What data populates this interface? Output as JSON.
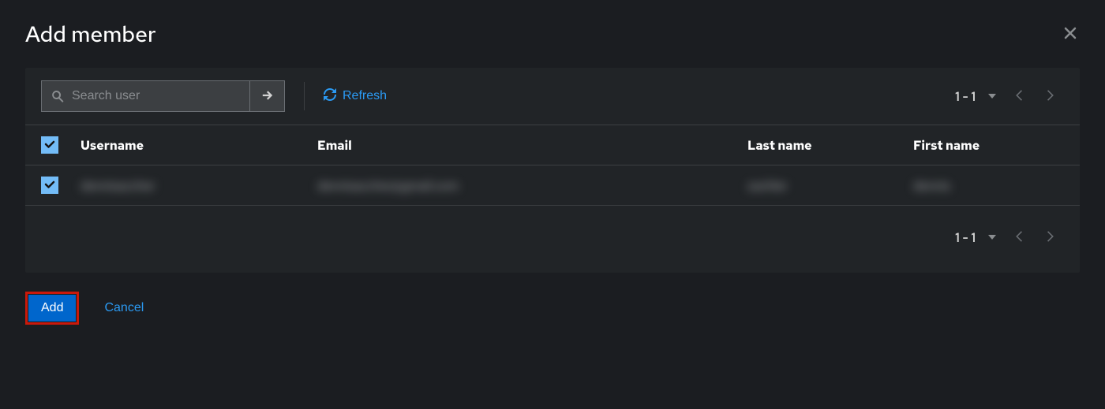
{
  "modal": {
    "title": "Add member"
  },
  "toolbar": {
    "search_placeholder": "Search user",
    "refresh_label": "Refresh"
  },
  "pagination": {
    "top_range": "1 - 1",
    "bottom_range": "1 - 1"
  },
  "table": {
    "headers": {
      "username": "Username",
      "email": "Email",
      "lastname": "Last name",
      "firstname": "First name"
    },
    "rows": [
      {
        "username": "dennisaccher",
        "email": "dennisaccher@gmail.com",
        "lastname": "zachler",
        "firstname": "dennis",
        "checked": true
      }
    ]
  },
  "footer": {
    "add_label": "Add",
    "cancel_label": "Cancel"
  }
}
